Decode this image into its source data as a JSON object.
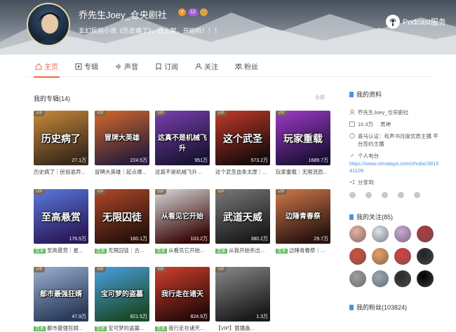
{
  "profile": {
    "name": "乔先生Joey_仓央剧社",
    "badge_level": "12",
    "signature": "玄幻民俗小说《历史病了》，已上架，开始听！！！",
    "podcast_label": "Podcast服务"
  },
  "nav": [
    {
      "label": "主页",
      "icon": "home-icon",
      "active": true
    },
    {
      "label": "专辑",
      "icon": "album-icon",
      "active": false
    },
    {
      "label": "声音",
      "icon": "sound-icon",
      "active": false
    },
    {
      "label": "订阅",
      "icon": "subscribe-icon",
      "active": false
    },
    {
      "label": "关注",
      "icon": "follow-icon",
      "active": false
    },
    {
      "label": "粉丝",
      "icon": "fans-icon",
      "active": false
    }
  ],
  "albums_section": {
    "title": "我的专辑(14)",
    "more": "全部"
  },
  "albums": [
    {
      "cover_text": "历史病了",
      "plays": "27.1万",
      "title": "历史病了｜民俗诡异...",
      "vip": true,
      "finished": false,
      "c1": "#c98a3a",
      "c2": "#3a2a1c"
    },
    {
      "cover_text": "冒牌大英雄",
      "plays": "224.5万",
      "title": "冒牌大英雄｜起点爆...",
      "vip": true,
      "finished": false,
      "c1": "#d46a2a",
      "c2": "#2b1d3a"
    },
    {
      "cover_text": "这真不是机械飞升",
      "plays": "951万",
      "title": "这真不是机械飞升...",
      "vip": true,
      "finished": false,
      "c1": "#7a3fb0",
      "c2": "#1b1436"
    },
    {
      "cover_text": "这个武圣",
      "plays": "573.2万",
      "title": "这个武圣血条太厚｜...",
      "vip": true,
      "finished": false,
      "c1": "#c23a2a",
      "c2": "#1a0c0c"
    },
    {
      "cover_text": "玩家重载",
      "plays": "1689.7万",
      "title": "玩家重载｜无限流恐...",
      "vip": true,
      "finished": false,
      "c1": "#a03ac8",
      "c2": "#1c1038"
    },
    {
      "cover_text": "至高悬赏",
      "plays": "176.5万",
      "title": "至高悬赏｜星...",
      "vip": true,
      "finished": true,
      "c1": "#5a7ae0",
      "c2": "#2a1a5a"
    },
    {
      "cover_text": "无限囚徒",
      "plays": "160.1万",
      "title": "无限囚徒｜古...",
      "vip": true,
      "finished": true,
      "c1": "#b0482a",
      "c2": "#2a120a"
    },
    {
      "cover_text": "从看见它开始",
      "plays": "103.2万",
      "title": "从看见它开始...",
      "vip": true,
      "finished": true,
      "c1": "#d8d8d8",
      "c2": "#3a0a0a"
    },
    {
      "cover_text": "武道天威",
      "plays": "380.2万",
      "title": "从我开始杀出...",
      "vip": true,
      "finished": true,
      "c1": "#7a7a7a",
      "c2": "#1a1a1a"
    },
    {
      "cover_text": "边陲青春祭",
      "plays": "29.7万",
      "title": "边陲青春祭｜...",
      "vip": true,
      "finished": true,
      "c1": "#d07a4a",
      "c2": "#2a1410"
    },
    {
      "cover_text": "都市最强狂婿",
      "plays": "47.9万",
      "title": "都市最强狂婿...",
      "vip": true,
      "finished": true,
      "c1": "#9ab0d0",
      "c2": "#2a3a5a"
    },
    {
      "cover_text": "宝可梦的盗墓",
      "plays": "821.5万",
      "title": "宝可梦的盗墓...",
      "vip": true,
      "finished": true,
      "c1": "#4aa0e0",
      "c2": "#1a4a2a"
    },
    {
      "cover_text": "我行走在诸天",
      "plays": "824.9万",
      "title": "我行走在诸天...",
      "vip": true,
      "finished": true,
      "c1": "#d0402a",
      "c2": "#2a0a0a"
    },
    {
      "cover_text": "",
      "plays": "1.3万",
      "title": "【VIP】菌播盎...",
      "vip": true,
      "finished": false,
      "c1": "#8a8a8a",
      "c2": "#1a1a1a"
    }
  ],
  "finished_label": "完本",
  "vip_label": "VIP",
  "sidebar": {
    "profile_title": "我的资料",
    "name": "乔先生Joey_仓央剧社",
    "age": "10.3万",
    "gender": "男神",
    "auth": "喜马认证：有声书月度优质主播 平台签约主播",
    "station_label": "个人电台",
    "station_url": "https://www.ximalaya.com/zhubo/381541109",
    "share_label": "分享到:",
    "follow_title": "我的关注(85)",
    "fans_title": "我的粉丝(103824)"
  },
  "follow_avatars": [
    "#e8b0a0",
    "#dde4ec",
    "#c9a8d8",
    "#b03a3a",
    "#d4503a",
    "#e8a060",
    "#d84040",
    "#222222",
    "#a0a0a0",
    "#9aa8b8",
    "#2a2a2a",
    "#000000"
  ]
}
